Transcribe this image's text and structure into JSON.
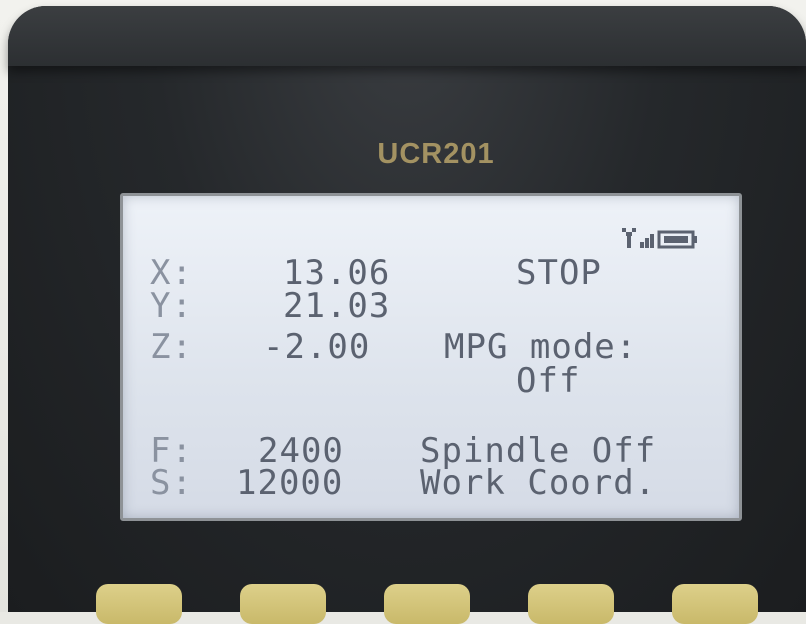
{
  "device": {
    "model": "UCR201"
  },
  "display": {
    "axes": [
      {
        "label": "X:",
        "value": "13.06"
      },
      {
        "label": "Y:",
        "value": "21.03"
      },
      {
        "label": "Z:",
        "value": "-2.00"
      }
    ],
    "machine_state": "STOP",
    "mpg_mode": {
      "label": "MPG mode:",
      "value": "Off"
    },
    "feed": {
      "label": "F:",
      "value": "2400"
    },
    "spindle_speed": {
      "label": "S:",
      "value": "12000"
    },
    "spindle_status": "Spindle Off",
    "coordinate_system": "Work Coord.",
    "status_icons": [
      "antenna-signal-icon",
      "signal-strength-icon",
      "battery-icon"
    ]
  },
  "colors": {
    "lcd_background": "#e3e8f0",
    "lcd_text": "#5b6270",
    "model_text": "#a39262",
    "button_yellow": "#d4c57a"
  }
}
